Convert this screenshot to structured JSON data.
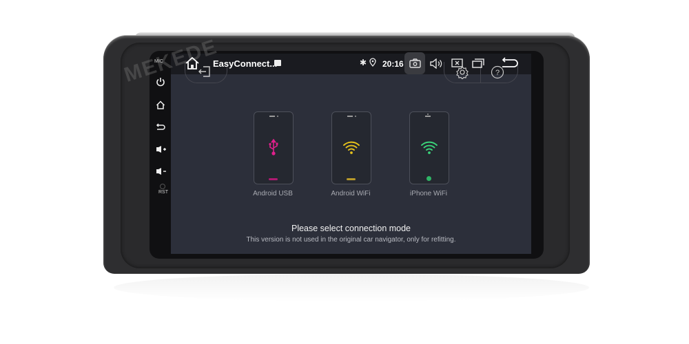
{
  "brand_watermark": "MEKEDE",
  "hardware": {
    "mic_label": "MIC",
    "rst_label": "RST",
    "buttons": [
      {
        "name": "power",
        "icon": "power-icon"
      },
      {
        "name": "home",
        "icon": "home-icon"
      },
      {
        "name": "back",
        "icon": "back-icon"
      },
      {
        "name": "volume-up",
        "icon": "volume-up-icon"
      },
      {
        "name": "volume-down",
        "icon": "volume-down-icon"
      }
    ]
  },
  "statusbar": {
    "app_title": "EasyConnect...",
    "time": "20:16",
    "icons": [
      "home-icon",
      "image-icon",
      "bluetooth-icon",
      "location-icon",
      "screenshot-icon",
      "volume-icon",
      "close-window-icon",
      "recent-apps-icon",
      "back-icon"
    ]
  },
  "app": {
    "exit_icon": "exit-icon",
    "settings_icon": "gear-icon",
    "help_icon": "help-icon",
    "modes": [
      {
        "label": "Android USB",
        "icon": "usb-icon",
        "color": "#e0208c"
      },
      {
        "label": "Android WiFi",
        "icon": "wifi-icon",
        "color": "#e6c21c"
      },
      {
        "label": "iPhone WiFi",
        "icon": "wifi-icon",
        "color": "#3ad47a"
      }
    ],
    "prompt": "Please select connection mode",
    "note": "This version is not used in the original car navigator, only for refitting."
  }
}
